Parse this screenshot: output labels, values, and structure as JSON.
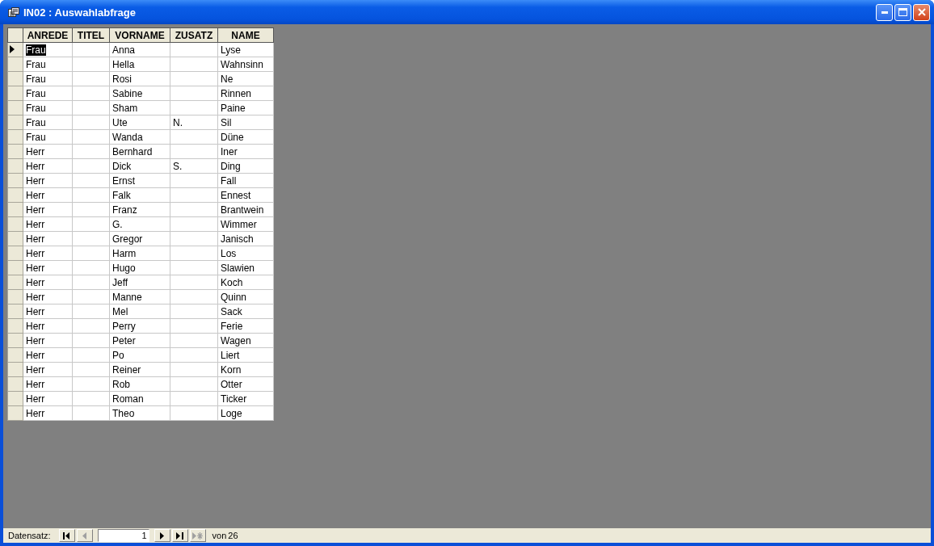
{
  "window": {
    "title": "IN02 : Auswahlabfrage"
  },
  "table": {
    "columns": [
      "ANREDE",
      "TITEL",
      "VORNAME",
      "ZUSATZ",
      "NAME"
    ],
    "rows": [
      {
        "anrede": "Frau",
        "vorname": "Anna",
        "name": "Lyse",
        "selected": true
      },
      {
        "anrede": "Frau",
        "vorname": "Hella",
        "name": "Wahnsinn",
        "selected": false
      },
      {
        "anrede": "Frau",
        "vorname": "Rosi",
        "name": "Ne",
        "selected": false
      },
      {
        "anrede": "Frau",
        "vorname": "Sabine",
        "name": "Rinnen",
        "selected": false
      },
      {
        "anrede": "Frau",
        "vorname": "Sham",
        "name": "Paine",
        "selected": false
      },
      {
        "anrede": "Frau",
        "vorname": "Ute",
        "zusatz": "N.",
        "name": "Sil",
        "selected": false
      },
      {
        "anrede": "Frau",
        "vorname": "Wanda",
        "name": "Düne",
        "selected": false
      },
      {
        "anrede": "Herr",
        "vorname": "Bernhard",
        "name": "Iner",
        "selected": false
      },
      {
        "anrede": "Herr",
        "vorname": "Dick",
        "zusatz": "S.",
        "name": "Ding",
        "selected": false
      },
      {
        "anrede": "Herr",
        "vorname": "Ernst",
        "name": "Fall",
        "selected": false
      },
      {
        "anrede": "Herr",
        "vorname": "Falk",
        "name": "Ennest",
        "selected": false
      },
      {
        "anrede": "Herr",
        "vorname": "Franz",
        "name": "Brantwein",
        "selected": false
      },
      {
        "anrede": "Herr",
        "vorname": "G.",
        "name": "Wimmer",
        "selected": false
      },
      {
        "anrede": "Herr",
        "vorname": "Gregor",
        "name": "Janisch",
        "selected": false
      },
      {
        "anrede": "Herr",
        "vorname": "Harm",
        "name": "Los",
        "selected": false
      },
      {
        "anrede": "Herr",
        "vorname": "Hugo",
        "name": "Slawien",
        "selected": false
      },
      {
        "anrede": "Herr",
        "vorname": "Jeff",
        "name": "Koch",
        "selected": false
      },
      {
        "anrede": "Herr",
        "vorname": "Manne",
        "name": "Quinn",
        "selected": false
      },
      {
        "anrede": "Herr",
        "vorname": "Mel",
        "name": "Sack",
        "selected": false
      },
      {
        "anrede": "Herr",
        "vorname": "Perry",
        "name": "Ferie",
        "selected": false
      },
      {
        "anrede": "Herr",
        "vorname": "Peter",
        "name": "Wagen",
        "selected": false
      },
      {
        "anrede": "Herr",
        "vorname": "Po",
        "name": "Liert",
        "selected": false
      },
      {
        "anrede": "Herr",
        "vorname": "Reiner",
        "name": "Korn",
        "selected": false
      },
      {
        "anrede": "Herr",
        "vorname": "Rob",
        "name": "Otter",
        "selected": false
      },
      {
        "anrede": "Herr",
        "vorname": "Roman",
        "name": "Ticker",
        "selected": false
      },
      {
        "anrede": "Herr",
        "vorname": "Theo",
        "name": "Loge",
        "selected": false
      }
    ]
  },
  "navigator": {
    "label": "Datensatz:",
    "record": "1",
    "total_label": "von",
    "total": "26",
    "buttons": [
      {
        "kind": "first",
        "disabled": false
      },
      {
        "kind": "prev",
        "disabled": true
      },
      {
        "kind": "field"
      },
      {
        "kind": "next",
        "disabled": false
      },
      {
        "kind": "last",
        "disabled": false
      },
      {
        "kind": "new",
        "disabled": true
      }
    ]
  }
}
